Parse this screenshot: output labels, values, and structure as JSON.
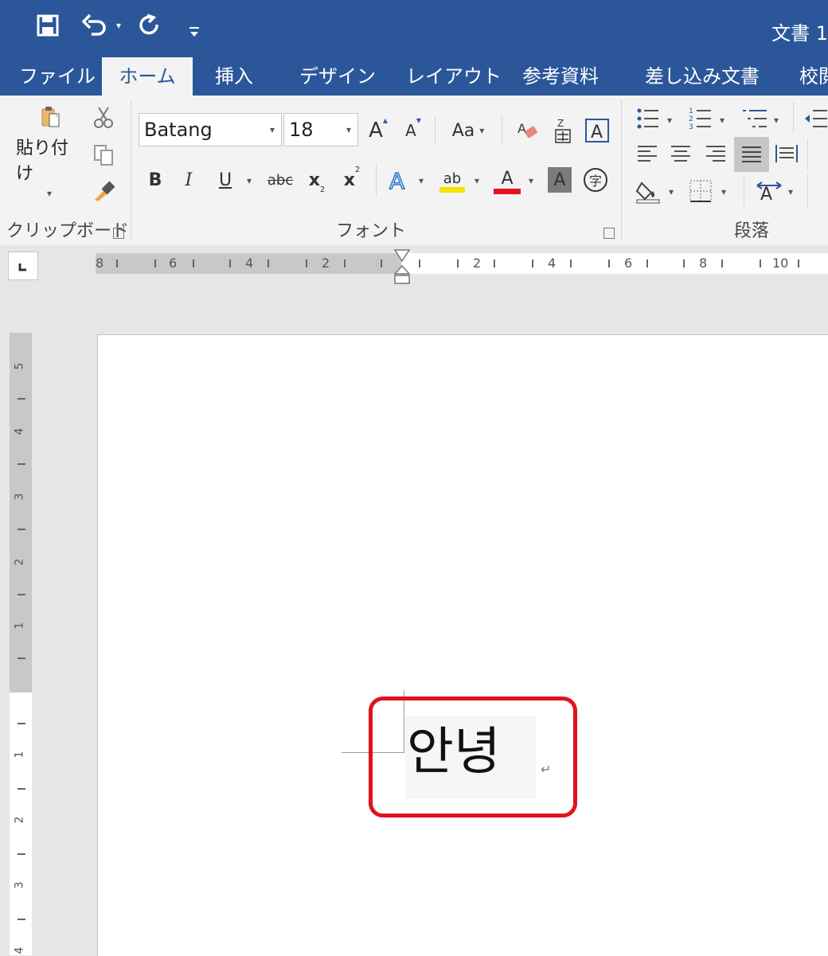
{
  "app": {
    "title": "文書 1"
  },
  "tabs": [
    {
      "label": "ファイル"
    },
    {
      "label": "ホーム"
    },
    {
      "label": "挿入"
    },
    {
      "label": "デザイン"
    },
    {
      "label": "レイアウト"
    },
    {
      "label": "参考資料"
    },
    {
      "label": "差し込み文書"
    },
    {
      "label": "校閲"
    }
  ],
  "ribbon": {
    "clipboard": {
      "paste_label": "貼り付け",
      "group_label": "クリップボード"
    },
    "font": {
      "group_label": "フォント",
      "font_name": "Batang",
      "font_size": "18",
      "change_case": "Aa",
      "bold": "B",
      "italic": "I",
      "underline": "U",
      "strikethrough": "abc",
      "subscript": "x",
      "superscript": "x",
      "grow": "A",
      "shrink": "A",
      "effects": "A",
      "color": "A",
      "shading": "A",
      "enclose": "字",
      "highlight": "ab"
    },
    "paragraph": {
      "group_label": "段落"
    }
  },
  "colors": {
    "accent": "#2b579a",
    "highlight": "#f5e200",
    "font_color": "#e81123",
    "annotation": "#e0141e"
  },
  "ruler": {
    "horizontal": [
      "8",
      "6",
      "4",
      "2",
      "2",
      "4",
      "6",
      "8",
      "10"
    ],
    "vertical": [
      "5",
      "4",
      "3",
      "2",
      "1",
      "1",
      "2",
      "3",
      "4"
    ]
  },
  "document": {
    "text": "안녕",
    "paragraph_mark": "↵"
  }
}
